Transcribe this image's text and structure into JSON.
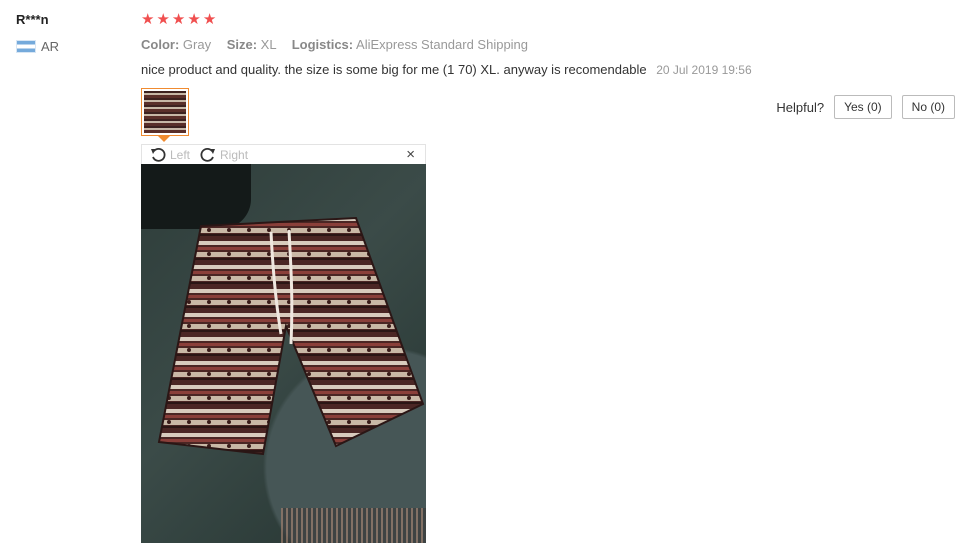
{
  "reviewer": {
    "name": "R***n",
    "country_code": "AR"
  },
  "rating": {
    "stars": 5,
    "max": 5,
    "symbol": "★"
  },
  "attributes": {
    "color_label": "Color:",
    "color_value": "Gray",
    "size_label": "Size:",
    "size_value": "XL",
    "logistics_label": "Logistics:",
    "logistics_value": "AliExpress Standard Shipping"
  },
  "review": {
    "text": "nice product and quality. the size is some big for me (1 70) XL. anyway is recomendable",
    "date": "20 Jul 2019 19:56"
  },
  "helpful": {
    "label": "Helpful?",
    "yes_label": "Yes (0)",
    "no_label": "No (0)"
  },
  "viewer": {
    "rotate_left_label": "Left",
    "rotate_right_label": "Right",
    "close_symbol": "×"
  },
  "colors": {
    "star": "#f04f4f",
    "thumb_border": "#f08b30"
  }
}
